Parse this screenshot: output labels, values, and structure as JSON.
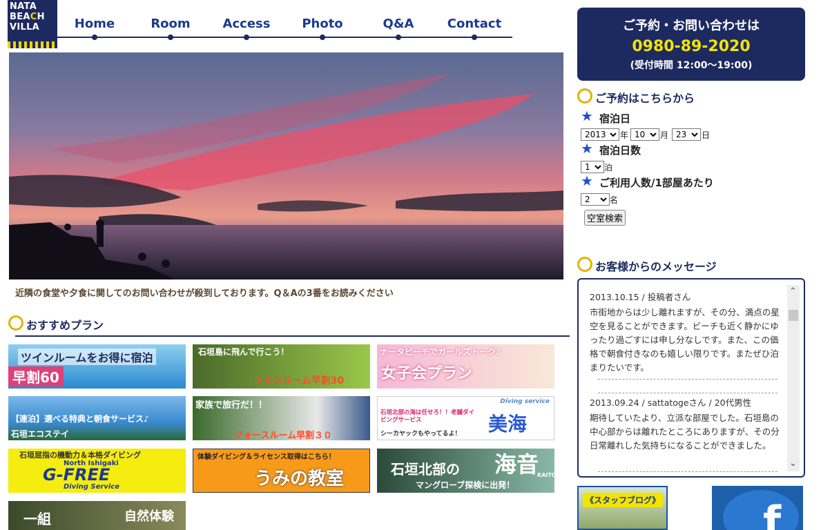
{
  "logo": {
    "line1": "NATA",
    "line2_a": "BEA",
    "line2_b": "C",
    "line2_c": "H",
    "line3": "VILLA"
  },
  "nav": {
    "items": [
      "Home",
      "Room",
      "Access",
      "Photo",
      "Q&A",
      "Contact"
    ]
  },
  "notice": "近隣の食堂や夕食に関してのお問い合わせが殺到しております。Q＆Aの3番をお読みください",
  "plans": {
    "title": "おすすめプラン",
    "banners": [
      {
        "text": "ツインルームをお得に宿泊",
        "sub": "早割60"
      },
      {
        "text": "石垣島に飛んで行こう！",
        "sub": "ツインルーム早割30"
      },
      {
        "text": "ナータビーチでガールズトーク♪",
        "sub": "女子会プラン"
      },
      {
        "text": "【連泊】選べる特典と朝食サービス♪",
        "sub": "石垣エコステイ"
      },
      {
        "text": "家族で旅行だ！！",
        "sub": "フォースルーム早割３０"
      },
      {
        "text": "石垣北部の海は任せろ！！老舗ダイビングサービス",
        "sub": "美海",
        "extra": "シーカヤックもやってるよ！",
        "tag": "Diving service"
      },
      {
        "text": "石垣屈指の機動力＆本格ダイビング",
        "sub": "G-FREE",
        "extra": "North Ishigaki",
        "tag": "Diving Service"
      },
      {
        "text": "体験ダイビング＆ライセンス取得はこちら！",
        "sub": "うみの教室"
      },
      {
        "text": "石垣北部の",
        "sub": "海音",
        "extra": "マングローブ探検に出発！",
        "tag": "KAITO"
      },
      {
        "text": "一組",
        "sub": "自然体験"
      }
    ]
  },
  "contact": {
    "line1": "ご予約・お問い合わせは",
    "phone": "0980-89-2020",
    "hours": "(受付時間 12:00〜19:00)"
  },
  "booking": {
    "title": "ご予約はこちらから",
    "date_label": "宿泊日",
    "year": "2013",
    "year_unit": "年",
    "month": "10",
    "month_unit": "月",
    "day": "23",
    "day_unit": "日",
    "nights_label": "宿泊日数",
    "nights": "1",
    "nights_unit": "泊",
    "guests_label": "ご利用人数/1部屋あたり",
    "guests": "2",
    "guests_unit": "名",
    "search_label": "空室検索"
  },
  "messages": {
    "title": "お客様からのメッセージ",
    "items": [
      {
        "meta": "2013.10.15 / 投稿者さん",
        "body": "市街地からは少し離れますが、その分、満点の星空を見ることができます。ビーチも近く静かにゆったり過ごすには申し分なしです。また、この価格で朝食付きなのも嬉しい限りです。またぜひ泊まりたいです。"
      },
      {
        "meta": "2013.09.24 / sattatogeさん / 20代男性",
        "body": "期待していたより、立派な部屋でした。石垣島の中心部からは離れたところにありますが、その分日常離れした気持ちになることができました。"
      }
    ]
  },
  "blog": {
    "label": "スタッフブログ"
  },
  "colors": {
    "navy": "#1d2a60",
    "accent_yellow": "#f3e400",
    "link_blue": "#1d3a8c"
  }
}
